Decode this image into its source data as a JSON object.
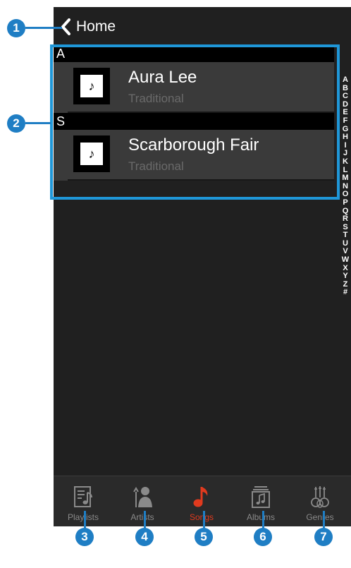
{
  "nav": {
    "back_label": "Home"
  },
  "sections": [
    {
      "header": "A",
      "song": {
        "title": "Aura Lee",
        "artist": "Traditional"
      }
    },
    {
      "header": "S",
      "song": {
        "title": "Scarborough Fair",
        "artist": "Traditional"
      }
    }
  ],
  "index_letters": [
    "A",
    "B",
    "C",
    "D",
    "E",
    "F",
    "G",
    "H",
    "I",
    "J",
    "K",
    "L",
    "M",
    "N",
    "O",
    "P",
    "Q",
    "R",
    "S",
    "T",
    "U",
    "V",
    "W",
    "X",
    "Y",
    "Z",
    "#"
  ],
  "tabs": [
    {
      "label": "Playlists",
      "icon": "playlists-icon"
    },
    {
      "label": "Artists",
      "icon": "artists-icon"
    },
    {
      "label": "Songs",
      "icon": "songs-icon",
      "active": true
    },
    {
      "label": "Albums",
      "icon": "albums-icon"
    },
    {
      "label": "Genres",
      "icon": "genres-icon"
    }
  ],
  "callouts": [
    "1",
    "2",
    "3",
    "4",
    "5",
    "6",
    "7"
  ],
  "album_art_glyph": "♪",
  "colors": {
    "accent": "#e03a1e",
    "callout": "#1f7ec4",
    "highlight": "#1f97d8",
    "background": "#202020"
  }
}
